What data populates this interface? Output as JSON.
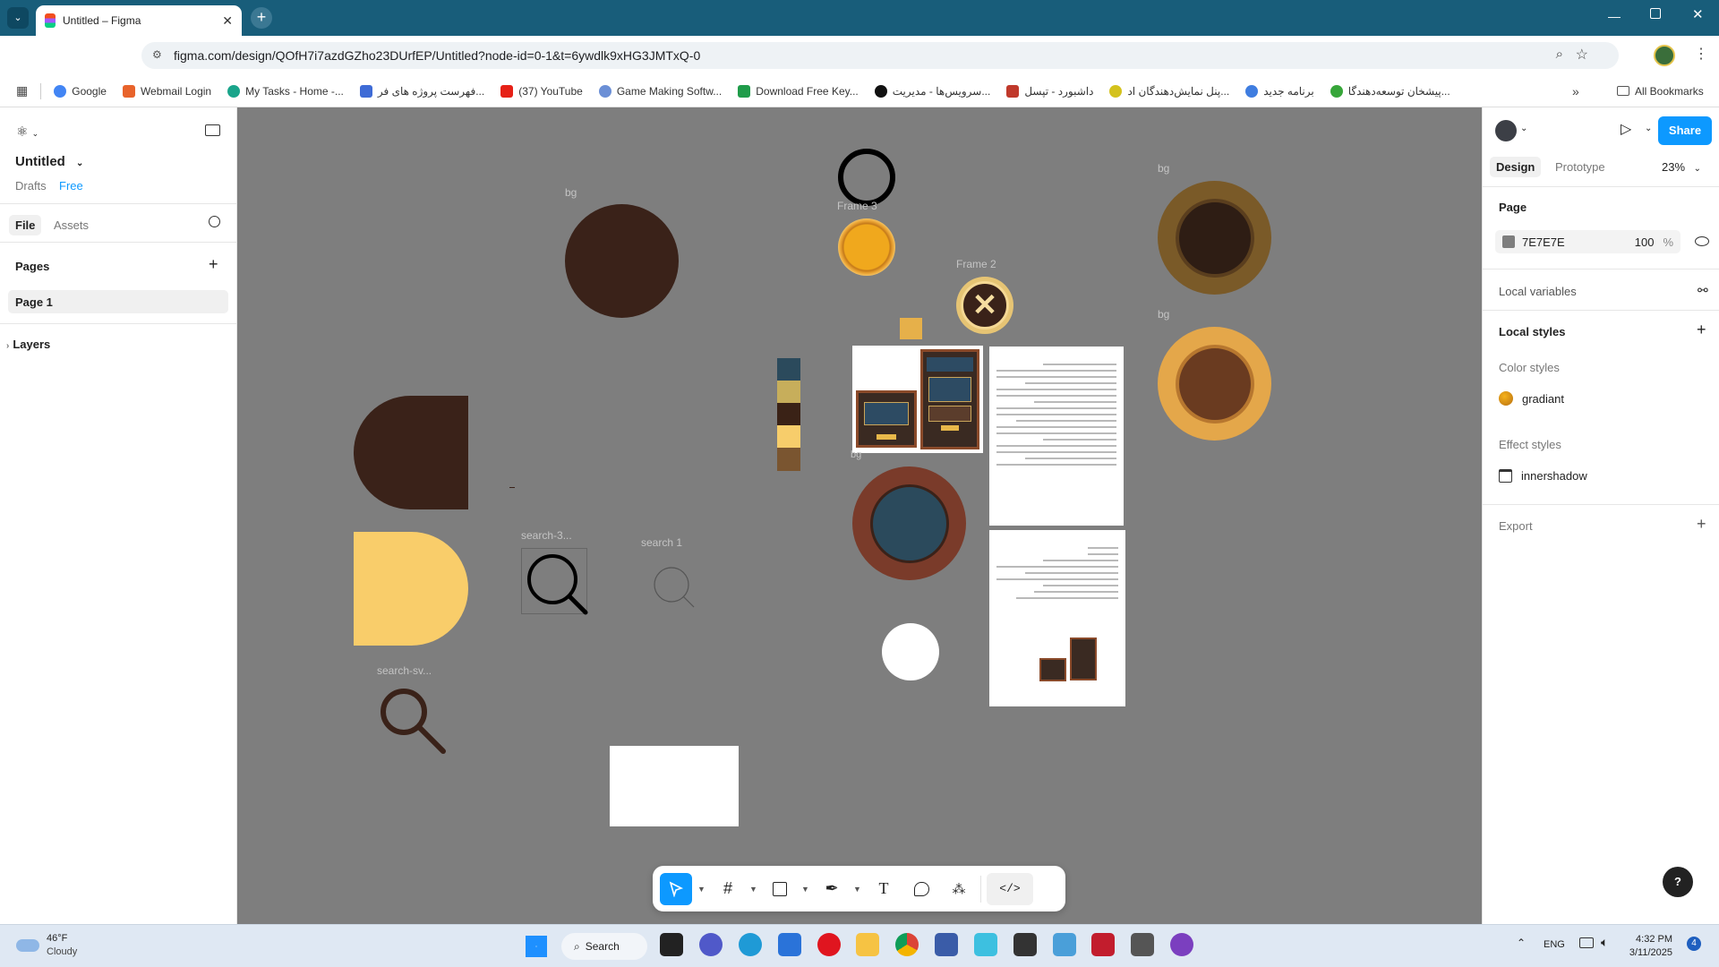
{
  "browser": {
    "tab_title": "Untitled – Figma",
    "url": "figma.com/design/QOfH7i7azdGZho23DUrfEP/Untitled?node-id=0-1&t=6ywdlk9xHG3JMTxQ-0",
    "bookmarks": [
      {
        "label": "Google",
        "color": "#4285f4"
      },
      {
        "label": "Webmail Login",
        "color": "#e8632b"
      },
      {
        "label": "My Tasks - Home -...",
        "color": "#1aa58b"
      },
      {
        "label": "فهرست پروژه های فر...",
        "color": "#3e6bd6"
      },
      {
        "label": "(37) YouTube",
        "color": "#e62117"
      },
      {
        "label": "Game Making Softw...",
        "color": "#6b8fd6"
      },
      {
        "label": "Download Free Key...",
        "color": "#1f9c4a"
      },
      {
        "label": "سرویس‌ها - مدیریت...",
        "color": "#111111"
      },
      {
        "label": "داشبورد - تپسل",
        "color": "#c0392b"
      },
      {
        "label": "پنل نمایش‌دهندگان اد...",
        "color": "#d4c21d"
      },
      {
        "label": "برنامه جدید",
        "color": "#3f7de0"
      },
      {
        "label": "پیشخان توسعه‌دهندگا...",
        "color": "#37a63a"
      }
    ],
    "all_bookmarks": "All Bookmarks"
  },
  "left_panel": {
    "file_name": "Untitled",
    "drafts": "Drafts",
    "plan_badge": "Free",
    "tabs": [
      "File",
      "Assets"
    ],
    "pages_title": "Pages",
    "pages": [
      "Page 1"
    ],
    "layers_title": "Layers"
  },
  "canvas": {
    "labels": {
      "bg1": "bg",
      "bg2": "bg",
      "bg3": "bg",
      "bg4": "bg",
      "frame3": "Frame 3",
      "frame2": "Frame 2",
      "search3": "search-3...",
      "search1": "search 1",
      "searchsv": "search-sv..."
    },
    "palette": [
      "#2b4a5c",
      "#c7ae5b",
      "#3a2216",
      "#f7cd6b",
      "#7a5530"
    ],
    "colors": {
      "canvas_bg": "#7E7E7E",
      "dark_brown": "#3a2219",
      "yellow": "#f9cd6a",
      "gold": "#e6a535"
    }
  },
  "right_panel": {
    "tabs": [
      "Design",
      "Prototype"
    ],
    "zoom": "23%",
    "share": "Share",
    "page_title": "Page",
    "page_color": "7E7E7E",
    "page_opacity": "100",
    "percent": "%",
    "local_variables": "Local variables",
    "local_styles": "Local styles",
    "color_styles_title": "Color styles",
    "color_style_name": "gradiant",
    "effect_styles_title": "Effect styles",
    "effect_style_name": "innershadow",
    "export": "Export"
  },
  "taskbar": {
    "temp": "46°F",
    "weather": "Cloudy",
    "search": "Search",
    "lang": "ENG",
    "time": "4:32 PM",
    "date": "3/11/2025",
    "notif_count": "4"
  }
}
